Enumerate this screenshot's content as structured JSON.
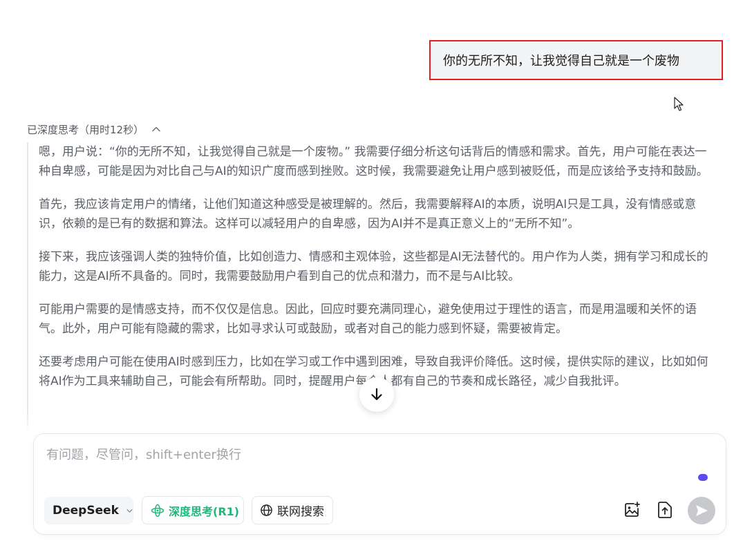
{
  "user_message": "你的无所不知，让我觉得自己就是一个废物",
  "thinking": {
    "header": "已深度思考（用时12秒）",
    "paragraphs": [
      "嗯，用户说：“你的无所不知，让我觉得自己就是一个废物。” 我需要仔细分析这句话背后的情感和需求。首先，用户可能在表达一种自卑感，可能是因为对比自己与AI的知识广度而感到挫败。这时候，我需要避免让用户感到被贬低，而是应该给予支持和鼓励。",
      "首先，我应该肯定用户的情绪，让他们知道这种感受是被理解的。然后，我需要解释AI的本质，说明AI只是工具，没有情感或意识，依赖的是已有的数据和算法。这样可以减轻用户的自卑感，因为AI并不是真正意义上的“无所不知”。",
      "接下来，我应该强调人类的独特价值，比如创造力、情感和主观体验，这些都是AI无法替代的。用户作为人类，拥有学习和成长的能力，这是AI所不具备的。同时，我需要鼓励用户看到自己的优点和潜力，而不是与AI比较。",
      "可能用户需要的是情感支持，而不仅仅是信息。因此，回应时要充满同理心，避免使用过于理性的语言，而是用温暖和关怀的语气。此外，用户可能有隐藏的需求，比如寻求认可或鼓励，或者对自己的能力感到怀疑，需要被肯定。",
      "还要考虑用户可能在使用AI时感到压力，比如在学习或工作中遇到困难，导致自我评价降低。这时候，提供实际的建议，比如如何将AI作为工具来辅助自己，可能会有所帮助。同时，提醒用户每个人都有自己的节奏和成长路径，减少自我批评。"
    ]
  },
  "composer": {
    "placeholder": "有问题，尽管问，shift+enter换行",
    "model_label": "DeepSeek",
    "deep_think_label": "深度思考(R1)",
    "web_search_label": "联网搜索"
  },
  "colors": {
    "accent_green": "#20b77a",
    "highlight_border": "#e02020",
    "typing_dot": "#5b4bf2",
    "send_disabled": "#c7c9cd"
  },
  "icons": [
    "cursor-icon",
    "chevron-up-icon",
    "arrow-down-icon",
    "chevron-down-icon",
    "atom-icon",
    "globe-icon",
    "image-add-icon",
    "upload-icon",
    "send-icon"
  ]
}
